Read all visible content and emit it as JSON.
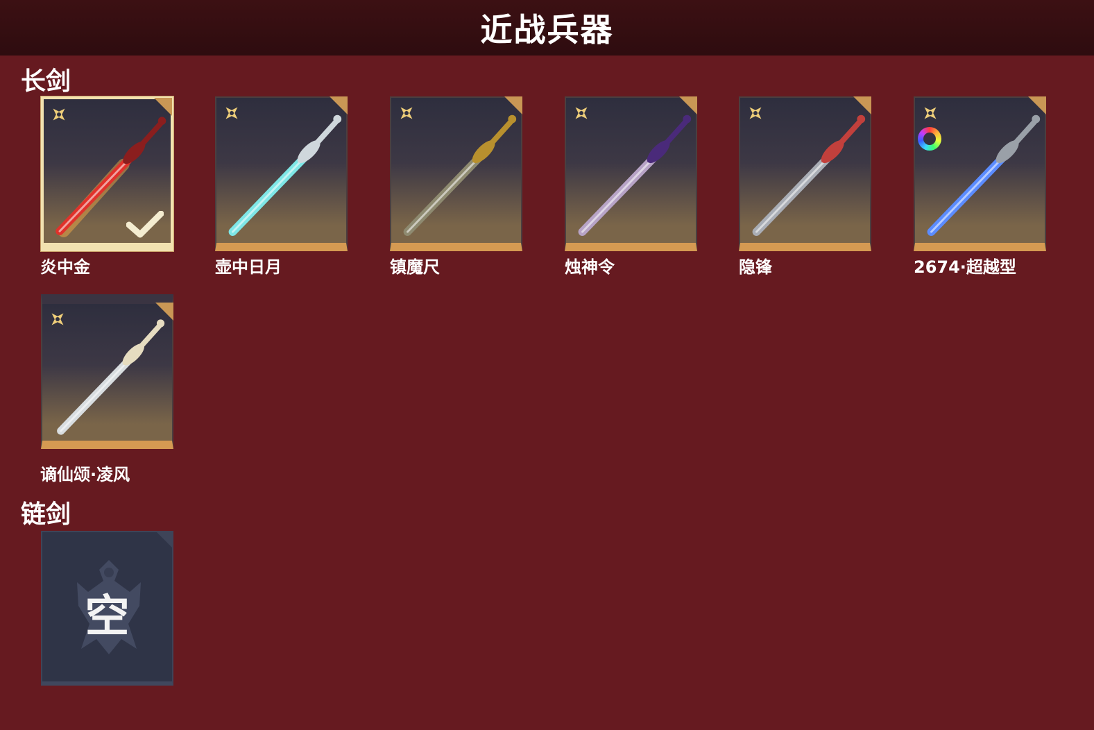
{
  "header": {
    "title": "近战兵器"
  },
  "sections": [
    {
      "title": "长剑",
      "items": [
        {
          "name": "炎中金",
          "selected": true,
          "blade_color": "#e0322b",
          "hilt_color": "#8a1e1e",
          "icon": "flame-sword-icon"
        },
        {
          "name": "壶中日月",
          "selected": false,
          "blade_color": "#7ee6e6",
          "hilt_color": "#cfd7dc",
          "icon": "jade-sword-icon"
        },
        {
          "name": "镇魔尺",
          "selected": false,
          "blade_color": "#8e8a70",
          "hilt_color": "#b8902e",
          "icon": "gold-sword-icon"
        },
        {
          "name": "烛神令",
          "selected": false,
          "blade_color": "#b7a3c6",
          "hilt_color": "#4a2a7a",
          "icon": "purple-curved-sword-icon"
        },
        {
          "name": "隐锋",
          "selected": false,
          "blade_color": "#a9adb5",
          "hilt_color": "#c2403c",
          "icon": "red-hilt-sword-icon"
        },
        {
          "name": "2674·超越型",
          "selected": false,
          "blade_color": "#5b8cff",
          "hilt_color": "#9aa0a8",
          "icon": "blue-energy-sword-icon",
          "ring": true
        }
      ]
    },
    {
      "items": [
        {
          "name": "谪仙颂·凌风",
          "selected": false,
          "blade_color": "#d8dde0",
          "hilt_color": "#e6dcc0",
          "icon": "white-sword-icon"
        }
      ]
    },
    {
      "title": "链剑",
      "items": [
        {
          "empty_label": "空"
        }
      ]
    }
  ],
  "colors": {
    "background": "#661a20",
    "topbar": "#2e0c0f",
    "card_bottom": "#d59a52",
    "selected_border": "#f2e2b0"
  }
}
